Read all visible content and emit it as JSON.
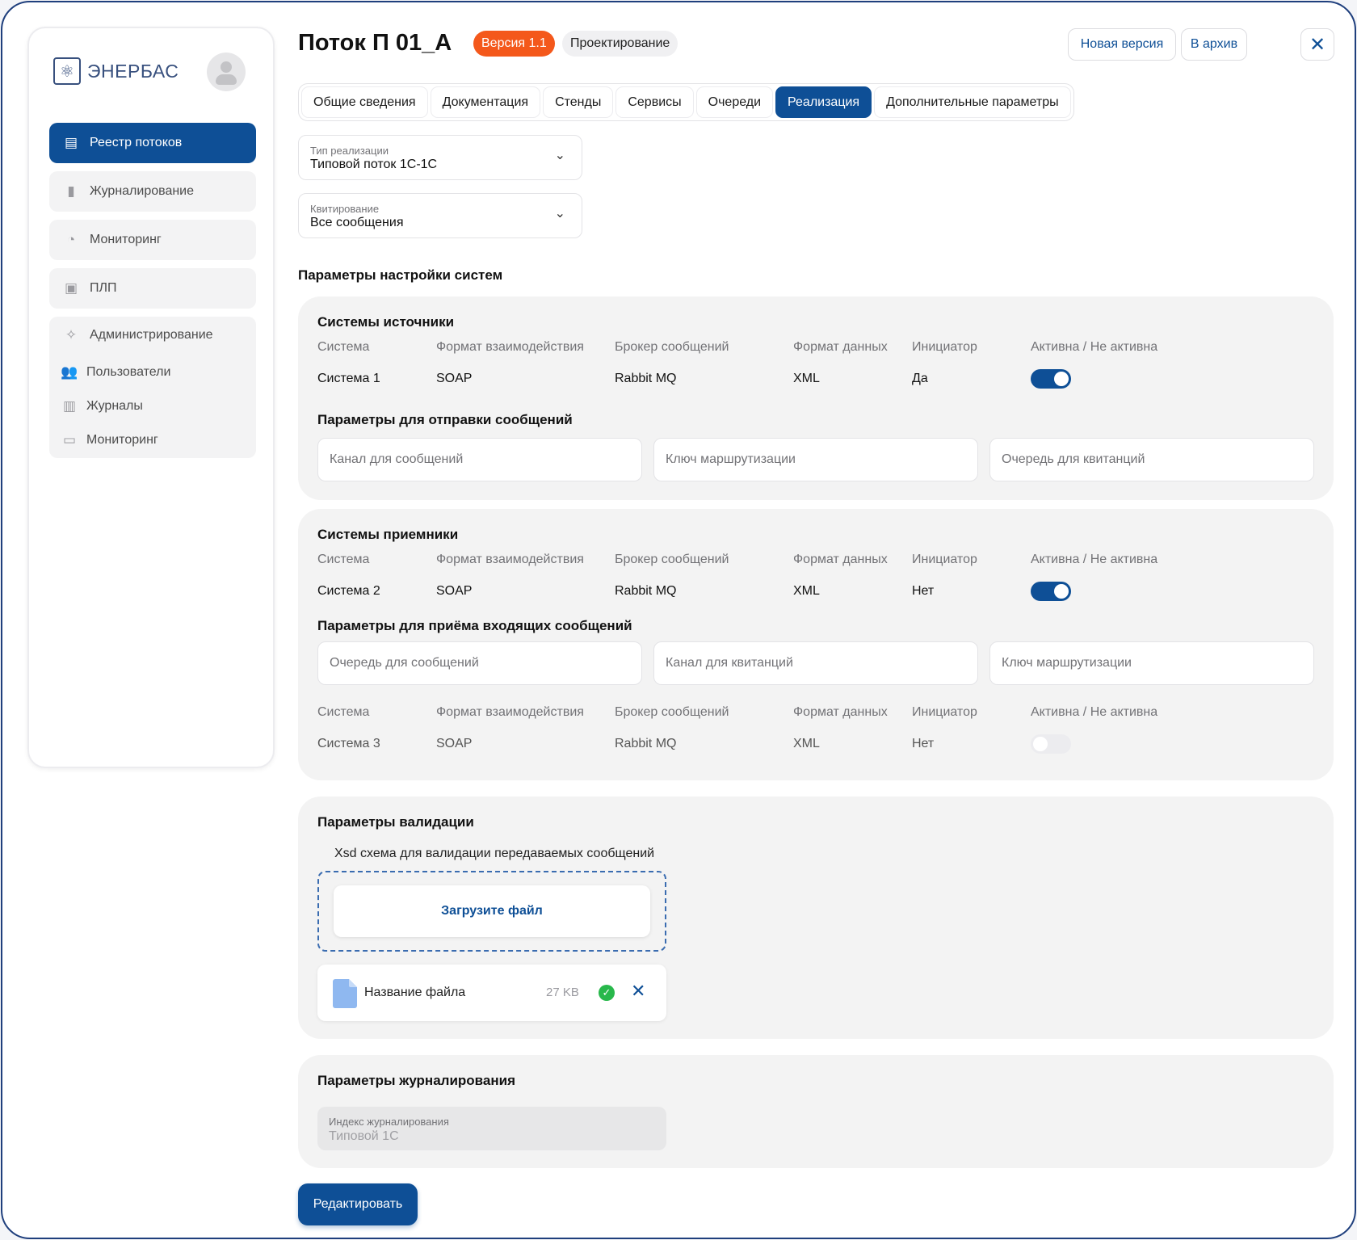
{
  "sidebar": {
    "logo_text": "ЭНЕРБАС",
    "items": [
      {
        "label": "Реестр потоков",
        "icon": "registry-icon",
        "active": true
      },
      {
        "label": "Журналирование",
        "icon": "journal-icon"
      },
      {
        "label": "Мониторинг",
        "icon": "pie-chart-icon"
      },
      {
        "label": "ПЛП",
        "icon": "terminal-icon"
      }
    ],
    "admin": {
      "label": "Администрирование",
      "children": [
        {
          "label": "Пользователи",
          "icon": "users-icon"
        },
        {
          "label": "Журналы",
          "icon": "logs-icon"
        },
        {
          "label": "Мониторинг",
          "icon": "monitor-icon"
        }
      ]
    }
  },
  "header": {
    "title": "Поток П 01_А",
    "version_badge": "Версия 1.1",
    "status_badge": "Проектирование",
    "new_version_label": "Новая версия",
    "archive_label": "В архив"
  },
  "tabs": [
    {
      "label": "Общие сведения"
    },
    {
      "label": "Документация"
    },
    {
      "label": "Стенды"
    },
    {
      "label": "Сервисы"
    },
    {
      "label": "Очереди"
    },
    {
      "label": "Реализация",
      "active": true
    },
    {
      "label": "Дополнительные параметры"
    }
  ],
  "impl_type": {
    "label": "Тип реализации",
    "value": "Типовой поток 1С-1С"
  },
  "ack": {
    "label": "Квитирование",
    "value": "Все сообщения"
  },
  "params_title": "Параметры настройки систем",
  "columns": [
    "Система",
    "Формат взаимодействия",
    "Брокер сообщений",
    "Формат данных",
    "Инициатор",
    "Активна / Не активна"
  ],
  "sources": {
    "title": "Системы источники",
    "row": {
      "system": "Система 1",
      "format": "SOAP",
      "broker": "Rabbit MQ",
      "data_format": "XML",
      "initiator": "Да",
      "active": true
    },
    "send_title": "Параметры для отправки сообщений",
    "fields": [
      "Канал для сообщений",
      "Ключ маршрутизации",
      "Очередь для квитанций"
    ]
  },
  "receivers": {
    "title": "Системы приемники",
    "row": {
      "system": "Система 2",
      "format": "SOAP",
      "broker": "Rabbit MQ",
      "data_format": "XML",
      "initiator": "Нет",
      "active": true
    },
    "recv_title": "Параметры для приёма входящих сообщений",
    "fields": [
      "Очередь для сообщений",
      "Канал для квитанций",
      "Ключ маршрутизации"
    ],
    "row2": {
      "system": "Система 3",
      "format": "SOAP",
      "broker": "Rabbit MQ",
      "data_format": "XML",
      "initiator": "Нет",
      "active": false
    }
  },
  "validation": {
    "title": "Параметры валидации",
    "xsd_label": "Xsd схема для валидации передаваемых сообщений",
    "upload_label": "Загрузите файл",
    "file_name": "Название файла",
    "file_size": "27 KB"
  },
  "logging": {
    "title": "Параметры журналирования",
    "index_label": "Индекс журналирования",
    "index_value": "Типовой 1С"
  },
  "edit_label": "Редактировать",
  "colors": {
    "primary": "#0e4f96",
    "badge_orange": "#f4581b",
    "success": "#28b84b"
  }
}
